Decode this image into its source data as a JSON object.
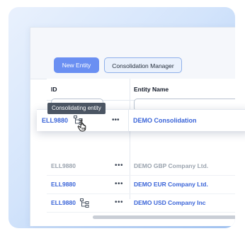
{
  "toolbar": {
    "new_entity_label": "New Entity",
    "consolidation_manager_label": "Consolidation Manager"
  },
  "table": {
    "columns": {
      "id": "ID",
      "entity_name": "Entity Name"
    },
    "rows": [
      {
        "id": "ELL9880",
        "name": "DEMO Consolidation",
        "consolidating": true,
        "muted": false
      },
      {
        "id": "ELL9880",
        "name": "DEMO GBP Company Ltd.",
        "consolidating": false,
        "muted": true
      },
      {
        "id": "ELL9880",
        "name": "DEMO EUR Company Ltd.",
        "consolidating": false,
        "muted": false
      },
      {
        "id": "ELL9880",
        "name": "DEMO USD Company Inc",
        "consolidating": true,
        "muted": false
      }
    ],
    "row_menu_glyph": "•••"
  },
  "tooltip": {
    "text": "Consolidating entity"
  },
  "icons": {
    "row_menu": "more-horizontal-icon",
    "consolidation": "hierarchy-tree-icon",
    "cursor": "hand-pointer-icon"
  },
  "colors": {
    "primary": "#6a8ff2",
    "link": "#3a64d8",
    "muted": "#9aa3ae",
    "tooltip_bg": "#4b5563"
  }
}
